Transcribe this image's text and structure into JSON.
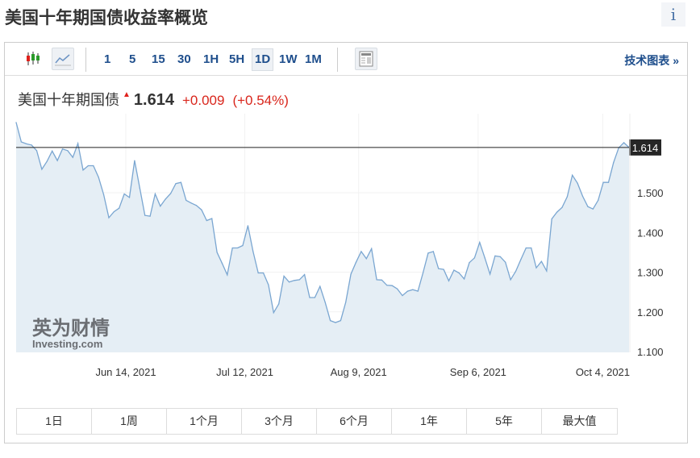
{
  "page_title": "美国十年期国债收益率概览",
  "info_label": "i",
  "toolbar": {
    "timeframes": [
      "1",
      "5",
      "15",
      "30",
      "1H",
      "5H",
      "1D",
      "1W",
      "1M"
    ],
    "selected_timeframe": "1D",
    "tech_chart_link": "技术图表 »"
  },
  "quote": {
    "name": "美国十年期国债",
    "price": "1.614",
    "change": "+0.009",
    "change_pct": "(+0.54%)"
  },
  "colors": {
    "line": "#7aa6d1",
    "fill": "#e5eef5",
    "up": "#d9261c",
    "link": "#1e4e8c"
  },
  "chart_data": {
    "type": "area",
    "title": "美国十年期国债",
    "ylim": [
      1.1,
      1.72
    ],
    "yticks": [
      1.1,
      1.2,
      1.3,
      1.4,
      1.5
    ],
    "ytick_labels": [
      "1.100",
      "1.200",
      "1.300",
      "1.400",
      "1.500"
    ],
    "current_value": 1.614,
    "current_label": "1.614",
    "xticks": [
      {
        "index": 21.3,
        "label": "Jun 14, 2021"
      },
      {
        "index": 44.4,
        "label": "Jul 12, 2021"
      },
      {
        "index": 66.5,
        "label": "Aug 9, 2021"
      },
      {
        "index": 89.7,
        "label": "Sep 6, 2021"
      },
      {
        "index": 113.9,
        "label": "Oct 4, 2021"
      }
    ],
    "values": [
      1.677,
      1.628,
      1.623,
      1.62,
      1.606,
      1.559,
      1.579,
      1.605,
      1.581,
      1.61,
      1.606,
      1.589,
      1.624,
      1.557,
      1.568,
      1.568,
      1.539,
      1.495,
      1.437,
      1.452,
      1.461,
      1.497,
      1.488,
      1.581,
      1.512,
      1.443,
      1.441,
      1.497,
      1.466,
      1.484,
      1.498,
      1.523,
      1.526,
      1.481,
      1.474,
      1.468,
      1.457,
      1.43,
      1.435,
      1.35,
      1.322,
      1.293,
      1.361,
      1.361,
      1.367,
      1.417,
      1.352,
      1.298,
      1.298,
      1.268,
      1.198,
      1.22,
      1.29,
      1.275,
      1.279,
      1.281,
      1.294,
      1.236,
      1.236,
      1.264,
      1.224,
      1.178,
      1.173,
      1.178,
      1.224,
      1.295,
      1.325,
      1.352,
      1.334,
      1.359,
      1.281,
      1.28,
      1.267,
      1.266,
      1.258,
      1.241,
      1.252,
      1.256,
      1.252,
      1.298,
      1.348,
      1.352,
      1.309,
      1.307,
      1.278,
      1.305,
      1.298,
      1.283,
      1.324,
      1.336,
      1.375,
      1.336,
      1.295,
      1.341,
      1.339,
      1.325,
      1.281,
      1.302,
      1.332,
      1.361,
      1.361,
      1.311,
      1.327,
      1.303,
      1.434,
      1.451,
      1.463,
      1.49,
      1.544,
      1.524,
      1.491,
      1.465,
      1.459,
      1.481,
      1.526,
      1.526,
      1.576,
      1.613,
      1.626,
      1.614
    ],
    "watermark": "英为财情 Investing.com"
  },
  "ranges": [
    "1日",
    "1周",
    "1个月",
    "3个月",
    "6个月",
    "1年",
    "5年",
    "最大值"
  ]
}
